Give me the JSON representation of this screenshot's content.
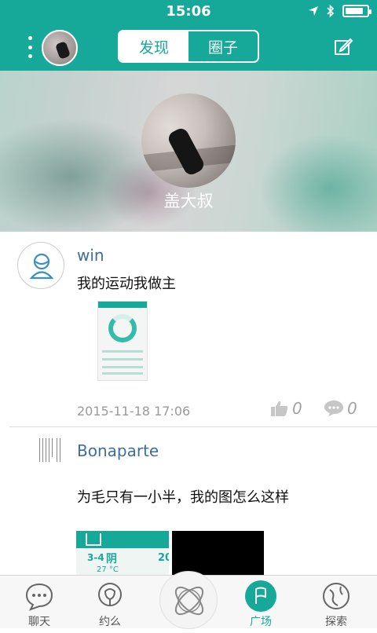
{
  "status_bar": {
    "time": "15:06",
    "battery_level": 0.85
  },
  "nav": {
    "tabs": [
      {
        "label": "发现",
        "active": true
      },
      {
        "label": "圈子",
        "active": false
      }
    ]
  },
  "banner": {
    "name": "盖大叔"
  },
  "posts": [
    {
      "username": "win",
      "text": "我的运动我做主",
      "date": "2015-11-18 17:06",
      "likes": "0",
      "comments": "0"
    },
    {
      "username": "Bonaparte",
      "text": "为毛只有一小半，我的图怎么这样",
      "thumb": {
        "date": "3-4",
        "weather": "阴",
        "temp": "27 °C",
        "extra": "20"
      }
    }
  ],
  "tabbar": {
    "items": [
      {
        "label": "聊天",
        "icon": "chat-bubble-icon"
      },
      {
        "label": "约么",
        "icon": "date-rose-icon"
      },
      {
        "label": "",
        "icon": "atom-icon"
      },
      {
        "label": "广场",
        "icon": "flag-icon",
        "active": true
      },
      {
        "label": "探索",
        "icon": "explore-icon"
      }
    ]
  },
  "colors": {
    "primary": "#16a99a",
    "username": "#3f6f98"
  }
}
